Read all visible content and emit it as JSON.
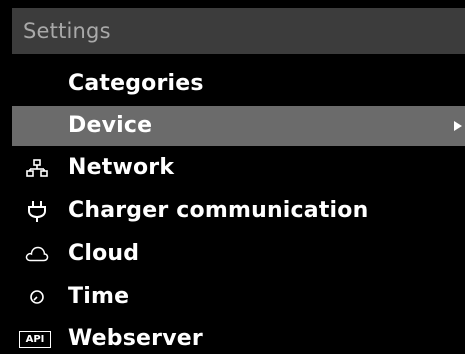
{
  "header": {
    "title": "Settings"
  },
  "menu": {
    "items": [
      {
        "label": "Categories",
        "icon": "",
        "selected": false
      },
      {
        "label": "Device",
        "icon": "",
        "selected": true,
        "has_submenu": true
      },
      {
        "label": "Network",
        "icon": "network-icon",
        "selected": false
      },
      {
        "label": "Charger communication",
        "icon": "plug-icon",
        "selected": false
      },
      {
        "label": "Cloud",
        "icon": "cloud-icon",
        "selected": false
      },
      {
        "label": "Time",
        "icon": "clock-icon",
        "selected": false
      },
      {
        "label": "Webserver",
        "icon": "api-icon",
        "icon_text": "API",
        "selected": false
      }
    ]
  },
  "colors": {
    "background": "#000000",
    "header_background": "#3c3c3c",
    "header_text": "#a9a9a9",
    "selected_row": "#6b6b6b",
    "text": "#ffffff"
  }
}
